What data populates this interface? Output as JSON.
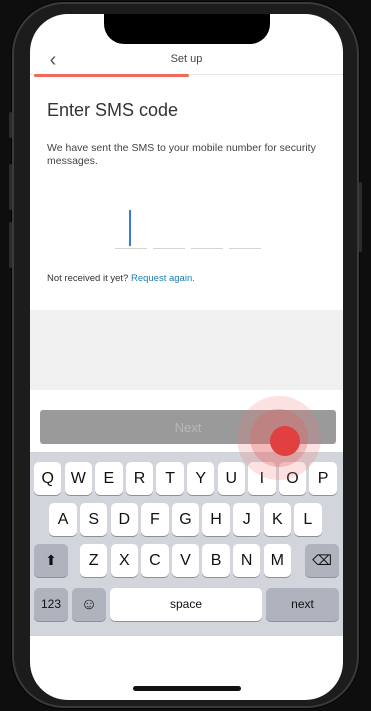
{
  "navbar": {
    "back_icon": "chevron-left-icon",
    "back_glyph": "‹",
    "title": "Set up"
  },
  "progress": {
    "fraction": 0.5,
    "color": "#f0695a"
  },
  "content": {
    "title": "Enter SMS code",
    "description": "We have sent the SMS to your mobile number for security messages.",
    "code_value": "",
    "resend_text": "Not received it yet?",
    "resend_link": "Request again."
  },
  "actions": {
    "next_label": "Next"
  },
  "keyboard": {
    "row1": [
      "Q",
      "W",
      "E",
      "R",
      "T",
      "Y",
      "U",
      "I",
      "O",
      "P"
    ],
    "row2": [
      "A",
      "S",
      "D",
      "F",
      "G",
      "H",
      "J",
      "K",
      "L"
    ],
    "row3": [
      "Z",
      "X",
      "C",
      "V",
      "B",
      "N",
      "M"
    ],
    "shift_icon": "shift-arrow-icon",
    "shift_glyph": "⬆",
    "backspace_icon": "backspace-icon",
    "backspace_glyph": "⌫",
    "numbers_label": "123",
    "emoji_icon": "emoji-icon",
    "emoji_glyph": "☺",
    "space_label": "space",
    "next_label": "next"
  },
  "colors": {
    "accent": "#f0695a",
    "link": "#1a7fb0",
    "tap_indicator": "#e04040"
  }
}
